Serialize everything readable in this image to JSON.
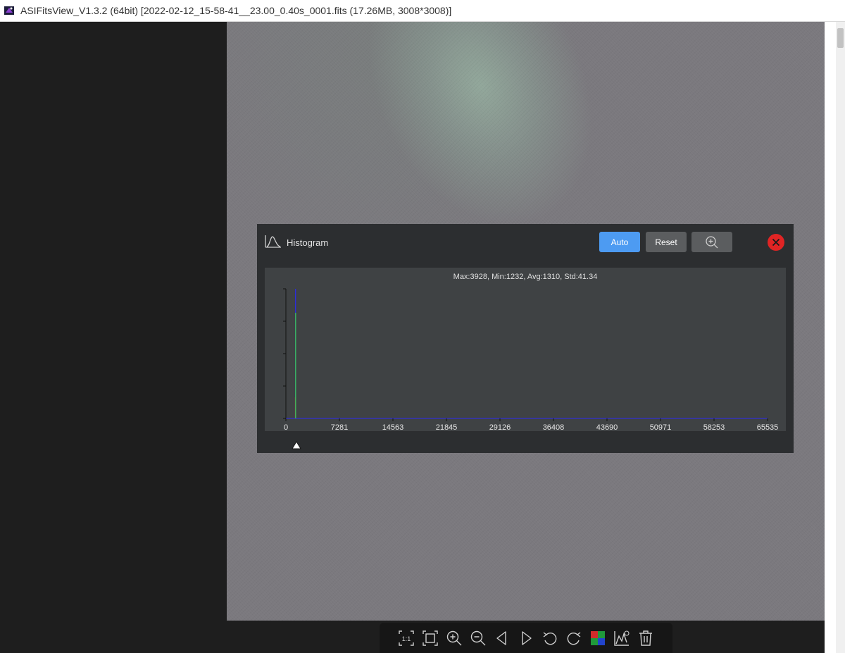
{
  "window": {
    "title": "ASIFitsView_V1.3.2 (64bit) [2022-02-12_15-58-41__23.00_0.40s_0001.fits (17.26MB, 3008*3008)]"
  },
  "histogram": {
    "title": "Histogram",
    "auto_label": "Auto",
    "reset_label": "Reset",
    "stats": "Max:3928, Min:1232, Avg:1310, Std:41.34",
    "accent_color": "#4d9bf2",
    "close_color": "#e02424"
  },
  "chart_data": {
    "type": "line",
    "x_ticks": [
      "0",
      "7281",
      "14563",
      "21845",
      "29126",
      "36408",
      "43690",
      "50971",
      "58253",
      "65535"
    ],
    "xlim": [
      0,
      65535
    ],
    "series": [
      {
        "color": "#2d2dd8",
        "peak_x": 1310
      },
      {
        "color": "#d83a3a",
        "peak_x": 1300
      },
      {
        "color": "#3ab85a",
        "peak_x": 1320
      }
    ],
    "black_point_marker": 1300
  },
  "toolbar": {
    "icons": [
      "actual-size-icon",
      "fit-screen-icon",
      "zoom-in-icon",
      "zoom-out-icon",
      "previous-icon",
      "next-icon",
      "rotate-left-icon",
      "rotate-right-icon",
      "debayer-icon",
      "histogram-icon",
      "delete-icon"
    ],
    "actual_size_label": "1:1"
  }
}
